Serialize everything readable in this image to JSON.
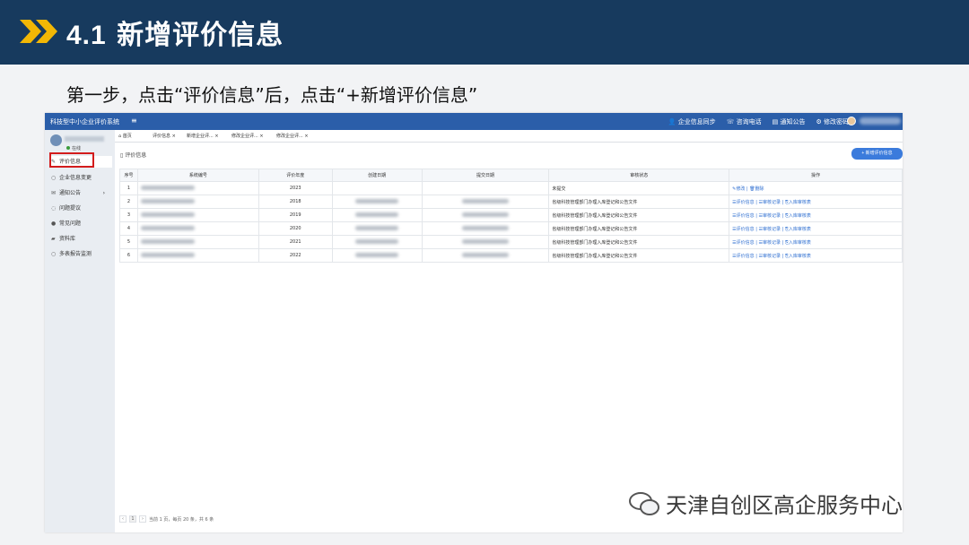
{
  "slide": {
    "title_num": "4.1",
    "title_text": "新增评价信息",
    "step": "第一步，点击“评价信息”后，点击“+新增评价信息”",
    "watermark": "天津自创区高企服务中心"
  },
  "topbar": {
    "app_title": "科技型中小企业评价系统",
    "menu_icon": "hamburger-icon",
    "links": [
      "企业信息同步",
      "咨询电话",
      "通知公告",
      "修改密码"
    ]
  },
  "sidebar": {
    "status": "在线",
    "items": [
      {
        "label": "评价信息",
        "icon": "✎"
      },
      {
        "label": "企业信息变更",
        "icon": "○"
      },
      {
        "label": "通知公告",
        "icon": "✉"
      },
      {
        "label": "问题提议",
        "icon": "◌"
      },
      {
        "label": "常见问题",
        "icon": "●"
      },
      {
        "label": "资料库",
        "icon": "▰"
      },
      {
        "label": "多表报告监测",
        "icon": "○"
      }
    ]
  },
  "tabs": [
    "首页",
    "评价信息 ×",
    "新增企业评... ×",
    "修改企业评... ×",
    "修改企业评... ×"
  ],
  "page": {
    "heading": "评价信息",
    "add_button": "+ 新增评价信息"
  },
  "table": {
    "headers": [
      "序号",
      "系统编号",
      "评价年度",
      "创建日期",
      "提交日期",
      "审核状态",
      "操作"
    ],
    "rows": [
      {
        "no": "1",
        "year": "2023",
        "status": "未提交",
        "ops": "✎修改 | 🗑删除"
      },
      {
        "no": "2",
        "year": "2018",
        "status": "省级科技管理部门办理入库登记和公告文件",
        "ops": "☰评价信息 | ☰审核记录 | ⎘入库审核表"
      },
      {
        "no": "3",
        "year": "2019",
        "status": "省级科技管理部门办理入库登记和公告文件",
        "ops": "☰评价信息 | ☰审核记录 | ⎘入库审核表"
      },
      {
        "no": "4",
        "year": "2020",
        "status": "省级科技管理部门办理入库登记和公告文件",
        "ops": "☰评价信息 | ☰审核记录 | ⎘入库审核表"
      },
      {
        "no": "5",
        "year": "2021",
        "status": "省级科技管理部门办理入库登记和公告文件",
        "ops": "☰评价信息 | ☰审核记录 | ⎘入库审核表"
      },
      {
        "no": "6",
        "year": "2022",
        "status": "省级科技管理部门办理入库登记和公告文件",
        "ops": "☰评价信息 | ☰审核记录 | ⎘入库审核表"
      }
    ]
  },
  "pager": {
    "prev": "‹",
    "page": "1",
    "next": "›",
    "summary": "当前 1 页，每页 20 条，共 6 条"
  }
}
